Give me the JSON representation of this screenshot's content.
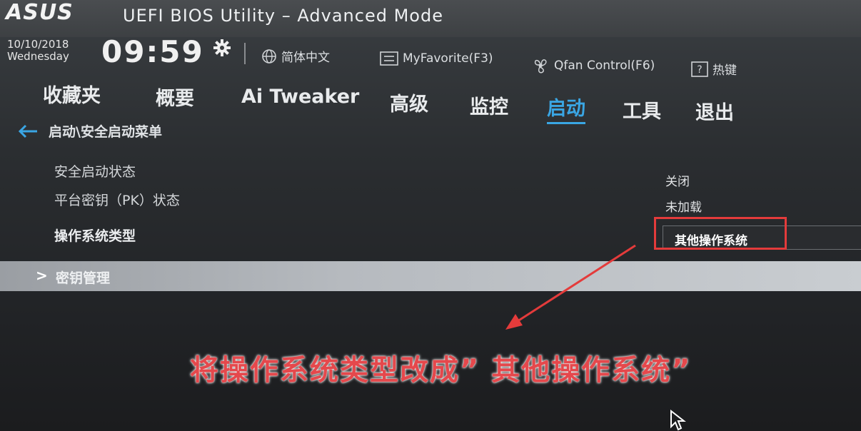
{
  "header": {
    "logo": "ASUS",
    "title": "UEFI BIOS Utility – Advanced Mode",
    "date": "10/10/2018",
    "weekday": "Wednesday",
    "time": "09:59",
    "language": "简体中文",
    "myfavorite": "MyFavorite(F3)",
    "qfan": "Qfan Control(F6)",
    "hotkeys": "热键"
  },
  "nav": {
    "tabs": [
      {
        "label": "收藏夹"
      },
      {
        "label": "概要"
      },
      {
        "label": "Ai Tweaker"
      },
      {
        "label": "高级"
      },
      {
        "label": "监控"
      },
      {
        "label": "启动",
        "active": true
      },
      {
        "label": "工具"
      },
      {
        "label": "退出"
      }
    ]
  },
  "breadcrumb": "启动\\安全启动菜单",
  "settings": [
    {
      "label": "安全启动状态",
      "value": "关闭"
    },
    {
      "label": "平台密钥（PK）状态",
      "value": "未加载"
    },
    {
      "label": "操作系统类型",
      "value": "其他操作系统"
    }
  ],
  "submenu": {
    "label": "密钥管理"
  },
  "caption": "将操作系统类型改成” 其他操作系统”",
  "colors": {
    "accent": "#3aa6e4",
    "annotation_red": "#e43b3b"
  }
}
